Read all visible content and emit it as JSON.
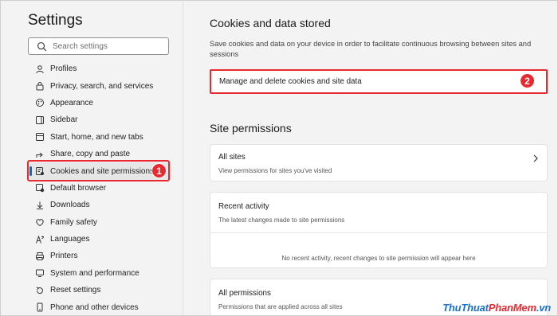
{
  "sidebar": {
    "title": "Settings",
    "search_placeholder": "Search settings",
    "items": [
      {
        "label": "Profiles",
        "icon": "profile-icon"
      },
      {
        "label": "Privacy, search, and services",
        "icon": "lock-icon"
      },
      {
        "label": "Appearance",
        "icon": "appearance-icon"
      },
      {
        "label": "Sidebar",
        "icon": "sidebar-icon"
      },
      {
        "label": "Start, home, and new tabs",
        "icon": "home-icon"
      },
      {
        "label": "Share, copy and paste",
        "icon": "share-icon"
      },
      {
        "label": "Cookies and site permissions",
        "icon": "cookie-permissions-icon"
      },
      {
        "label": "Default browser",
        "icon": "browser-icon"
      },
      {
        "label": "Downloads",
        "icon": "download-icon"
      },
      {
        "label": "Family safety",
        "icon": "family-icon"
      },
      {
        "label": "Languages",
        "icon": "language-icon"
      },
      {
        "label": "Printers",
        "icon": "printer-icon"
      },
      {
        "label": "System and performance",
        "icon": "system-icon"
      },
      {
        "label": "Reset settings",
        "icon": "reset-icon"
      },
      {
        "label": "Phone and other devices",
        "icon": "phone-icon"
      }
    ],
    "active_index": 6
  },
  "main": {
    "cookies_heading": "Cookies and data stored",
    "cookies_desc": "Save cookies and data on your device in order to facilitate continuous browsing between sites and sessions",
    "manage_label": "Manage and delete cookies and site data",
    "site_permissions_heading": "Site permissions",
    "all_sites_title": "All sites",
    "all_sites_sub": "View permissions for sites you've visited",
    "recent_activity_title": "Recent activity",
    "recent_activity_sub": "The latest changes made to site permissions",
    "recent_activity_empty": "No recent activity, recent changes to site permission will appear here",
    "all_permissions_title": "All permissions",
    "all_permissions_sub": "Permissions that are applied across all sites"
  },
  "annotations": {
    "badge_1": "1",
    "badge_2": "2"
  },
  "watermark": {
    "part1": "ThuThuat",
    "part2": "PhanMem",
    "part3": ".vn"
  },
  "colors": {
    "accent": "#0f6cbd",
    "highlight": "#e8292f"
  }
}
